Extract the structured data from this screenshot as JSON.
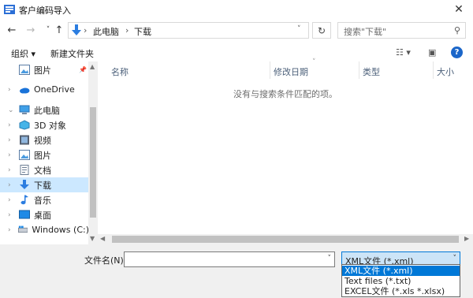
{
  "window": {
    "title": "客户编码导入",
    "close_glyph": "✕"
  },
  "address": {
    "back_glyph": "←",
    "forward_glyph": "→",
    "recent_glyph": "˅",
    "up_glyph": "↑",
    "crumbs": [
      "此电脑",
      "下载"
    ],
    "separator": "›",
    "dropdown_glyph": "˅",
    "refresh_glyph": "↻"
  },
  "search": {
    "placeholder": "搜索\"下载\"",
    "icon_glyph": "⚲"
  },
  "toolbar": {
    "organize": "组织 ▾",
    "new_folder": "新建文件夹",
    "view_glyph": "☷ ▾",
    "pane_glyph": "▣",
    "help": "?"
  },
  "nav": {
    "items": [
      {
        "label": "图片",
        "icon": "pictures-icon",
        "chev": "",
        "pin": "📌"
      },
      {
        "label": "OneDrive",
        "icon": "onedrive-icon",
        "chev": "›"
      },
      {
        "label": "此电脑",
        "icon": "this-pc-icon",
        "chev": "⌄"
      },
      {
        "label": "3D 对象",
        "icon": "3d-objects-icon",
        "chev": "›"
      },
      {
        "label": "视频",
        "icon": "videos-icon",
        "chev": "›"
      },
      {
        "label": "图片",
        "icon": "pictures-icon",
        "chev": "›"
      },
      {
        "label": "文档",
        "icon": "documents-icon",
        "chev": "›"
      },
      {
        "label": "下载",
        "icon": "downloads-icon",
        "chev": "›",
        "selected": true
      },
      {
        "label": "音乐",
        "icon": "music-icon",
        "chev": "›"
      },
      {
        "label": "桌面",
        "icon": "desktop-icon",
        "chev": "›"
      },
      {
        "label": "Windows (C:)",
        "icon": "drive-icon",
        "chev": "›"
      }
    ]
  },
  "list": {
    "columns": [
      "名称",
      "修改日期",
      "类型",
      "大小"
    ],
    "empty_message": "没有与搜索条件匹配的项。",
    "sort_glyph": "˅"
  },
  "bottom": {
    "filename_label": "文件名(N):",
    "filename_value": "",
    "filter_value": "XML文件 (*.xml)",
    "dropdown_glyph": "˅",
    "filter_options": [
      "XML文件 (*.xml)",
      "Text files (*.txt)",
      "EXCEL文件 (*.xls *.xlsx)"
    ],
    "selected_option_index": 0
  },
  "colors": {
    "accent": "#0078d7",
    "selection": "#cce8ff",
    "folder": "#e8b84a"
  }
}
